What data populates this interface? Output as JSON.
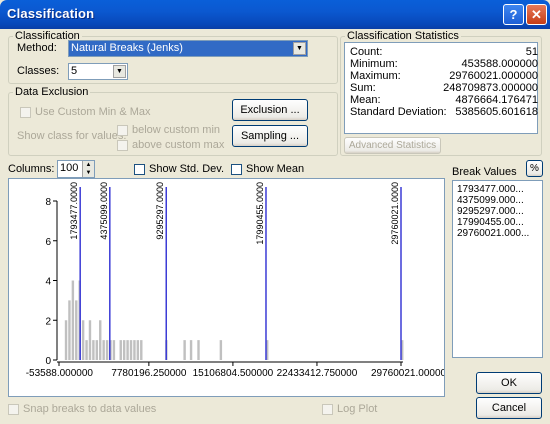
{
  "window": {
    "title": "Classification",
    "help_label": "?",
    "close_label": "✕"
  },
  "classification": {
    "group_label": "Classification",
    "method_label": "Method:",
    "method_value": "Natural Breaks (Jenks)",
    "classes_label": "Classes:",
    "classes_value": "5"
  },
  "exclusion": {
    "group_label": "Data Exclusion",
    "use_custom_label": "Use Custom Min & Max",
    "show_class_label": "Show class for values:",
    "below_label": "below custom min",
    "above_label": "above custom max",
    "exclusion_button": "Exclusion ...",
    "sampling_button": "Sampling ..."
  },
  "stats": {
    "group_label": "Classification Statistics",
    "rows": [
      {
        "key": "Count:",
        "value": "51"
      },
      {
        "key": "Minimum:",
        "value": "453588.000000"
      },
      {
        "key": "Maximum:",
        "value": "29760021.000000"
      },
      {
        "key": "Sum:",
        "value": "248709873.000000"
      },
      {
        "key": "Mean:",
        "value": "4876664.176471"
      },
      {
        "key": "Standard Deviation:",
        "value": "5385605.601618"
      }
    ],
    "advanced_button": "Advanced Statistics"
  },
  "controls": {
    "columns_label": "Columns:",
    "columns_value": "100",
    "show_std_label": "Show Std. Dev.",
    "show_mean_label": "Show Mean",
    "break_values_label": "Break Values",
    "percent_label": "%",
    "snap_label": "Snap breaks to data values",
    "log_label": "Log Plot",
    "ok_label": "OK",
    "cancel_label": "Cancel"
  },
  "break_values": [
    "1793477.000...",
    "4375099.000...",
    "9295297.000...",
    "17990455.00...",
    "29760021.000..."
  ],
  "chart_data": {
    "type": "bar",
    "x_range": [
      -53588,
      29760021
    ],
    "ylim": [
      0,
      8
    ],
    "y_ticks": [
      "0",
      "2",
      "4",
      "6",
      "8"
    ],
    "x_ticks": [
      {
        "value": -53588,
        "label": "-53588.000000"
      },
      {
        "value": 7780196.25,
        "label": "7780196.250000"
      },
      {
        "value": 15106804.5,
        "label": "15106804.500000"
      },
      {
        "value": 22433412.75,
        "label": "22433412.750000"
      },
      {
        "value": 29760021,
        "label": "29760021.000000"
      }
    ],
    "breaks": [
      {
        "value": 1793477,
        "label": "1793477.0000"
      },
      {
        "value": 4375099,
        "label": "4375099.0000"
      },
      {
        "value": 9295297,
        "label": "9295297.0000"
      },
      {
        "value": 17990455,
        "label": "17990455.0000"
      },
      {
        "value": 29760021,
        "label": "29760021.0000"
      }
    ],
    "histogram": {
      "bin_width": 298136,
      "bins": [
        {
          "x": 453588,
          "count": 2
        },
        {
          "x": 751724,
          "count": 3
        },
        {
          "x": 1049860,
          "count": 4
        },
        {
          "x": 1347996,
          "count": 3
        },
        {
          "x": 1646132,
          "count": 4
        },
        {
          "x": 1944268,
          "count": 2
        },
        {
          "x": 2242404,
          "count": 1
        },
        {
          "x": 2540540,
          "count": 2
        },
        {
          "x": 2838676,
          "count": 1
        },
        {
          "x": 3136812,
          "count": 1
        },
        {
          "x": 3434948,
          "count": 2
        },
        {
          "x": 3733084,
          "count": 1
        },
        {
          "x": 4031220,
          "count": 1
        },
        {
          "x": 4329356,
          "count": 1
        },
        {
          "x": 4627492,
          "count": 1
        },
        {
          "x": 5223764,
          "count": 1
        },
        {
          "x": 5521900,
          "count": 1
        },
        {
          "x": 5820036,
          "count": 1
        },
        {
          "x": 6118172,
          "count": 1
        },
        {
          "x": 6416308,
          "count": 1
        },
        {
          "x": 6714444,
          "count": 1
        },
        {
          "x": 7012580,
          "count": 1
        },
        {
          "x": 9198700,
          "count": 1
        },
        {
          "x": 10791900,
          "count": 1
        },
        {
          "x": 11353000,
          "count": 1
        },
        {
          "x": 12002700,
          "count": 1
        },
        {
          "x": 13952000,
          "count": 1
        },
        {
          "x": 17990455,
          "count": 1
        },
        {
          "x": 29760021,
          "count": 1
        }
      ]
    },
    "colors": {
      "bars": "#c0c0c0",
      "breaks": "#3b3bd6"
    }
  }
}
